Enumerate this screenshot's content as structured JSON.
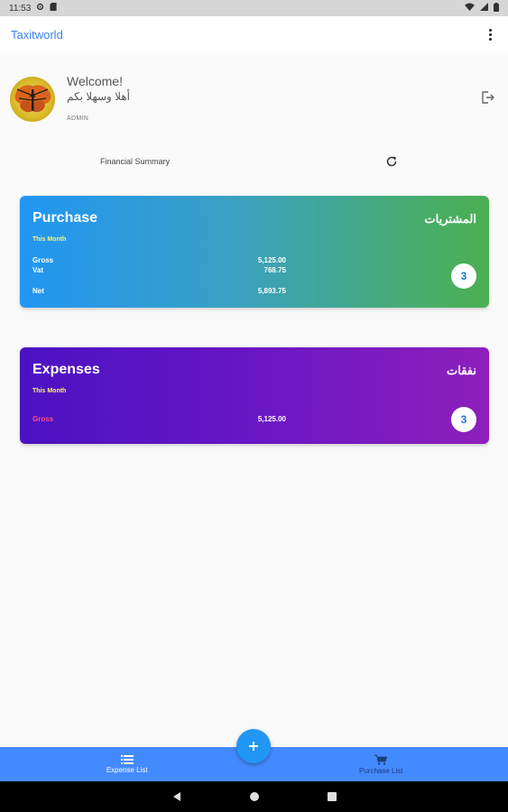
{
  "status_bar": {
    "time": "11:53"
  },
  "app_bar": {
    "title": "Taxitworld"
  },
  "profile": {
    "welcome": "Welcome!",
    "welcome_ar": "أهلا وسهلا بكم",
    "role": "ADMIN"
  },
  "summary": {
    "label": "Financial Summary"
  },
  "purchase_card": {
    "title": "Purchase",
    "title_ar": "المشتريات",
    "period": "This Month",
    "rows": [
      {
        "label": "Gross",
        "value": "5,125.00"
      },
      {
        "label": "Vat",
        "value": "768.75"
      },
      {
        "label": "Net",
        "value": "5,893.75"
      }
    ],
    "count": "3"
  },
  "expenses_card": {
    "title": "Expenses",
    "title_ar": "نفقات",
    "period": "This Month",
    "rows": [
      {
        "label": "Gross",
        "value": "5,125.00"
      }
    ],
    "count": "3"
  },
  "bottom_nav": {
    "items": [
      {
        "label": "Expense List",
        "icon": "list-icon"
      },
      {
        "label": "Purchase List",
        "icon": "cart-icon"
      }
    ],
    "fab_icon": "plus-icon"
  },
  "colors": {
    "accent": "#448aff",
    "fab": "#2196f3",
    "purchase_start": "#2196f3",
    "purchase_end": "#4caf50",
    "expenses_start": "#4b12c2",
    "expenses_end": "#8e1fbb",
    "period_text": "#fff176",
    "expenses_gross_label": "#ff4f8b"
  }
}
